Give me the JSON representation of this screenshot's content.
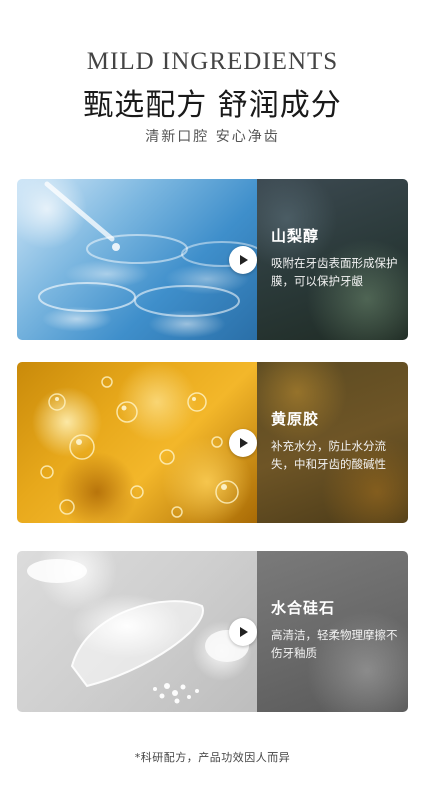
{
  "header": {
    "kicker": "MILD INGREDIENTS",
    "title": "甄选配方 舒润成分",
    "subtitle": "清新口腔 安心净齿"
  },
  "ingredients": [
    {
      "name": "山梨醇",
      "description": "吸附在牙齿表面形成保护膜，可以保护牙龈",
      "image": "blue-lab-glassware",
      "icon": "play-icon"
    },
    {
      "name": "黄原胶",
      "description": "补充水分，防止水分流失，中和牙齿的酸碱性",
      "image": "golden-gel-bubbles",
      "icon": "play-icon"
    },
    {
      "name": "水合硅石",
      "description": "高清洁，轻柔物理摩擦不伤牙釉质",
      "image": "white-silica-powder",
      "icon": "play-icon"
    }
  ],
  "footnote": "*科研配方，产品功效因人而异",
  "colors": {
    "background": "#ffffff",
    "text": "#1a1a1a",
    "panel_text": "#ffffff"
  }
}
